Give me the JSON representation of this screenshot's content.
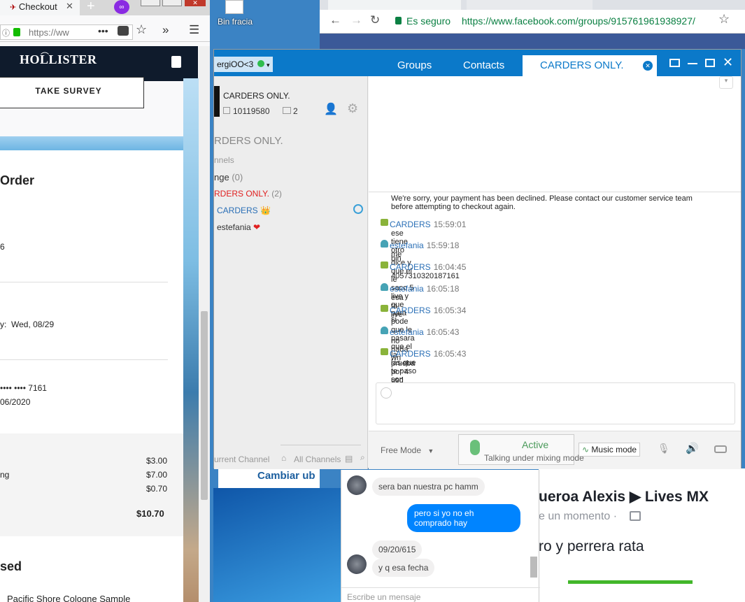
{
  "firefox": {
    "tab_title": "Checkout",
    "url": "https://ww",
    "brand": "HOLLISTER",
    "survey_button": "TAKE SURVEY",
    "order": {
      "heading": "Order",
      "fragment_6": "6",
      "delivery_fragment": "y:  Wed, 08/29",
      "card": "•••• •••• 7161",
      "expiry": "06/2020",
      "price_1": "$3.00",
      "label_2": "ng",
      "price_2": "$7.00",
      "price_3": "$0.70",
      "total": "$10.70",
      "section_2": "sed",
      "product": "Pacific Shore Cologne Sample"
    }
  },
  "desktop": {
    "icon_label": "Bin fracia"
  },
  "chrome": {
    "secure_label": "Es seguro",
    "url": "https://www.facebook.com/groups/915761961938927/"
  },
  "teamspeak": {
    "user": "ergiOO<3",
    "tabs": [
      "Groups",
      "Contacts"
    ],
    "active_tab": "CARDERS ONLY.",
    "server_name": "CARDERS ONLY.",
    "server_id": "10119580",
    "server_users": "2",
    "channel_header": "RDERS ONLY.",
    "channels_label": "nnels",
    "channels": [
      {
        "name": "nge",
        "count": "(0)"
      },
      {
        "name": "RDERS ONLY.",
        "count": "(2)"
      }
    ],
    "members": [
      "CARDERS",
      "estefania"
    ],
    "bottom_left": "urrent Channel",
    "bottom_mid": "All Channels",
    "log": [
      {
        "kind": "system",
        "text": "We're sorry, your payment has been declined. Please contact our customer service team before attempting to checkout again."
      },
      {
        "kind": "crown",
        "name": "CARDERS",
        "time": "15:59:01",
        "text": "ese tiene otro bin"
      },
      {
        "kind": "person",
        "name": "estefania",
        "time": "15:59:18",
        "text": "me dice y que el le saco 5 live y que para pode que le pasara que el la prueba por 4 usd"
      },
      {
        "kind": "crown",
        "name": "CARDERS",
        "time": "16:04:45",
        "text": "4057310320187161"
      },
      {
        "kind": "person",
        "name": "estefania",
        "time": "16:05:18",
        "text": "esa ta live"
      },
      {
        "kind": "crown",
        "name": "CARDERS",
        "time": "16:05:34",
        "text": "si"
      },
      {
        "kind": "person",
        "name": "estefania",
        "time": "16:05:43",
        "text": "no nada wn"
      },
      {
        "kind": "crown",
        "name": "CARDERS",
        "time": "16:05:43",
        "text": "las que te paso son recien sacadas"
      }
    ],
    "free_mode": "Free Mode",
    "active_label": "Active",
    "active_sub": "Talking under mixing mode",
    "music_mode": "Music mode"
  },
  "messenger": {
    "cambiar": "Cambiar ub",
    "msg1": "sera ban nuestra pc hamm",
    "msg2": "pero si yo no eh comprado hay",
    "msg3": "09/20/615",
    "msg4": "y q esa fecha",
    "input_placeholder": "Escribe un mensaje"
  },
  "facebook": {
    "post_title": "ueroa Alexis ▶ Lives MX",
    "post_sub": "e un momento ·",
    "post_text": "ro y perrera rata"
  },
  "colors": {
    "ts_blue": "#0b79c9",
    "fb_blue": "#3b5998",
    "messenger_blue": "#0084ff",
    "declined_red": "#e02020"
  }
}
